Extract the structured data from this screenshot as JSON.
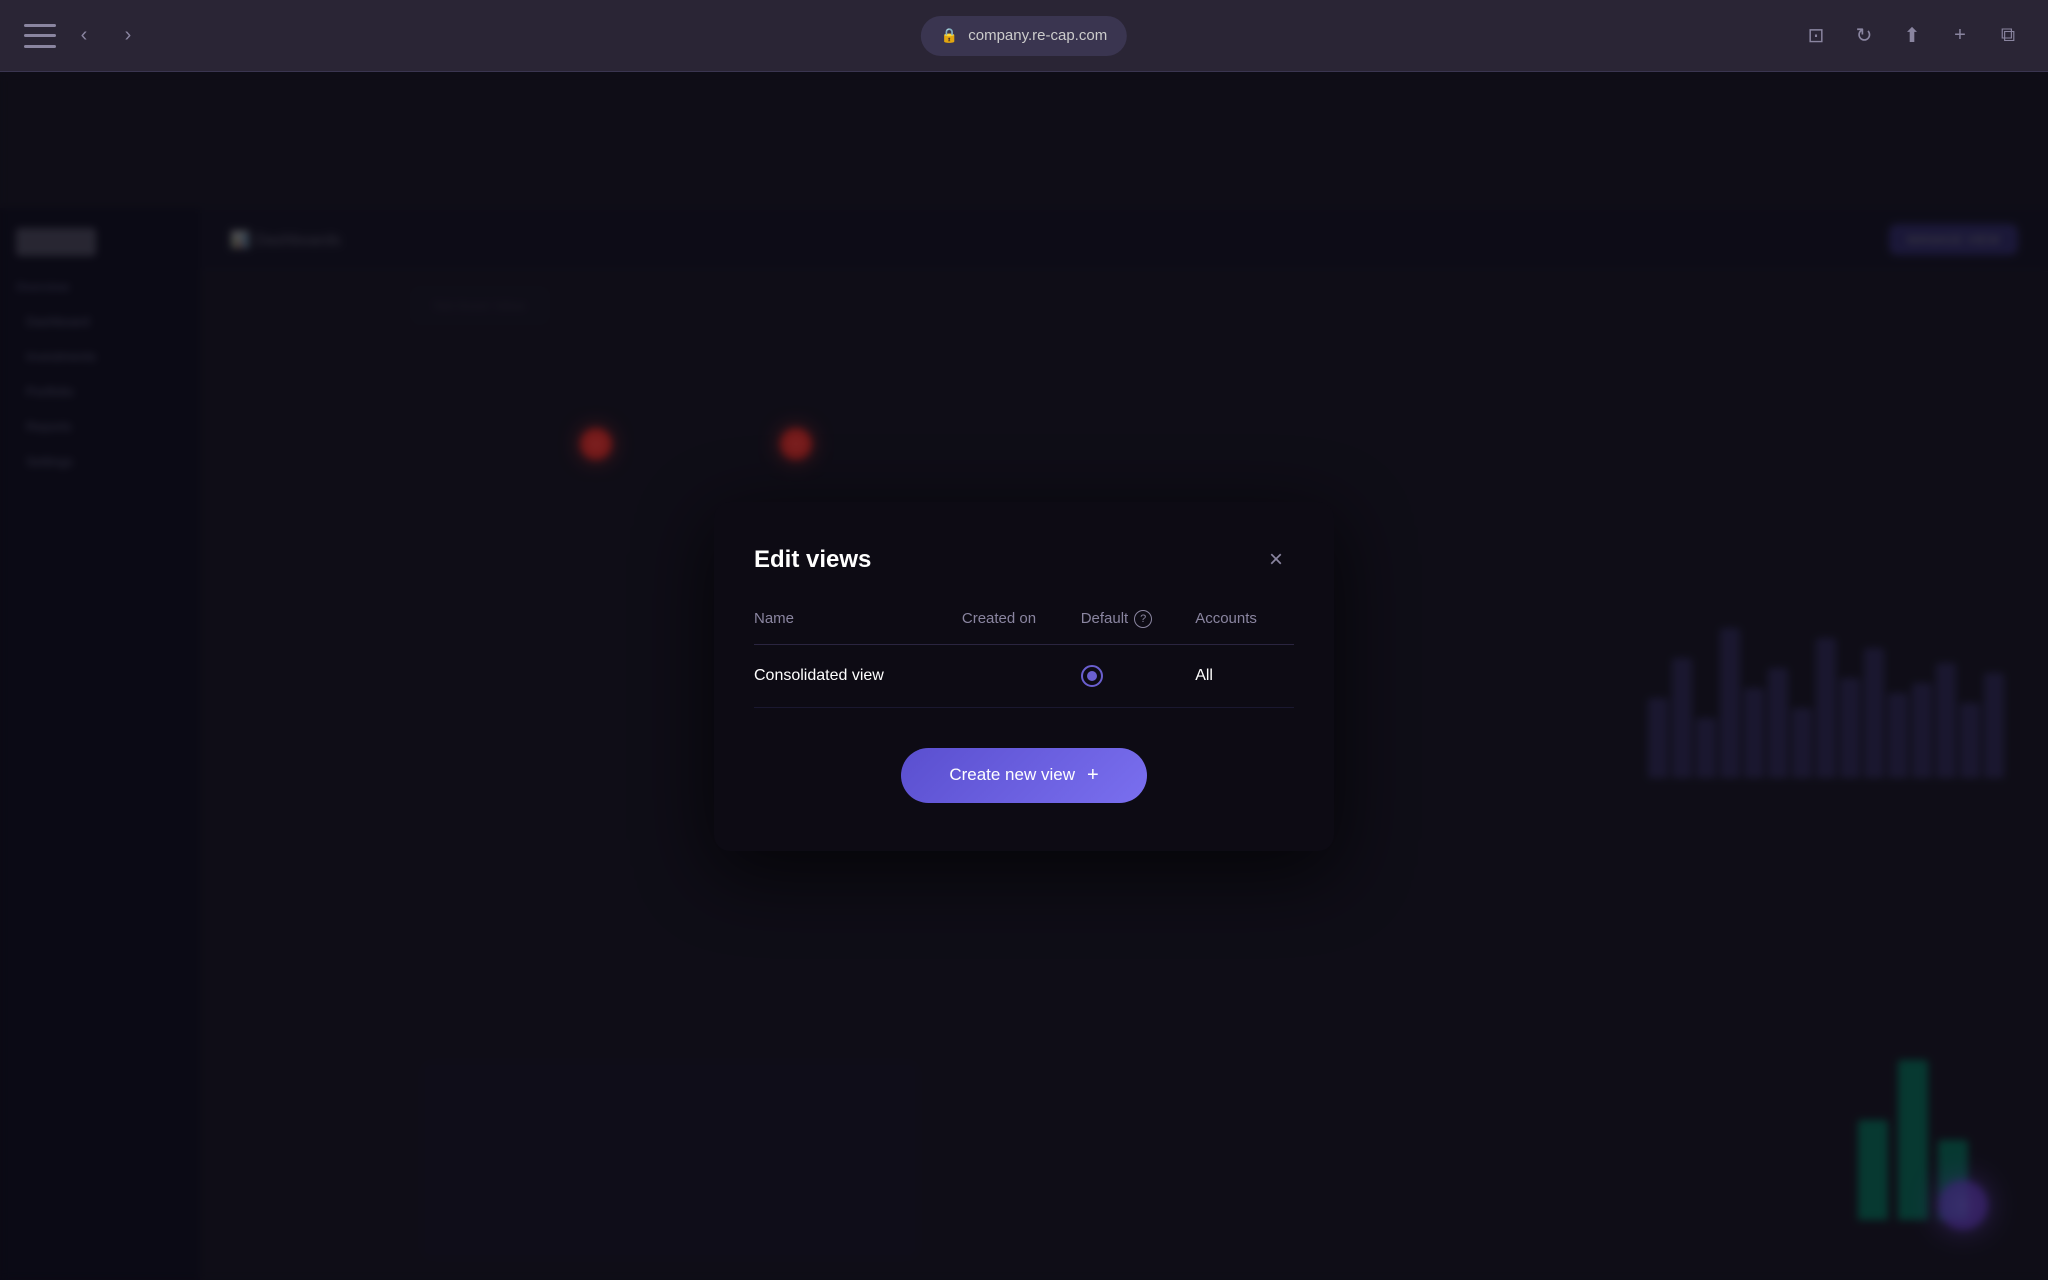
{
  "browser": {
    "url": "company.re-cap.com",
    "back_label": "‹",
    "forward_label": "›",
    "share_label": "⬆",
    "new_tab_label": "+",
    "tabs_label": "⧉"
  },
  "app": {
    "logo_text": "re-cap",
    "nav_item": "Dashboards",
    "top_button": "MANAGE VIEW"
  },
  "sidebar": {
    "section1_label": "Overview",
    "items": [
      {
        "label": "Dashboard"
      },
      {
        "label": "Investments"
      },
      {
        "label": "Portfolio"
      },
      {
        "label": "Reports"
      },
      {
        "label": "Settings"
      }
    ]
  },
  "modal": {
    "title": "Edit views",
    "close_label": "×",
    "table": {
      "headers": [
        {
          "key": "name",
          "label": "Name"
        },
        {
          "key": "created_on",
          "label": "Created on"
        },
        {
          "key": "default",
          "label": "Default"
        },
        {
          "key": "accounts",
          "label": "Accounts"
        }
      ],
      "rows": [
        {
          "name": "Consolidated view",
          "created_on": "",
          "default": true,
          "accounts": "All"
        }
      ]
    },
    "create_button_label": "Create new view",
    "create_button_icon": "+"
  },
  "background": {
    "bars": [
      80,
      120,
      60,
      150,
      90,
      110,
      70,
      140,
      100,
      130,
      85,
      95,
      115,
      75,
      105
    ],
    "green_bars": [
      100,
      160,
      80
    ]
  }
}
